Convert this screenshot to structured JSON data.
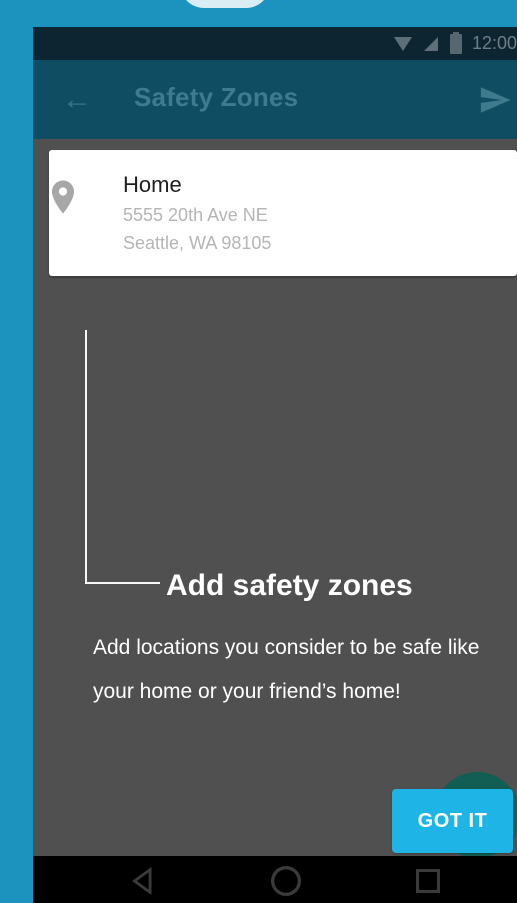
{
  "statusbar": {
    "time": "12:00",
    "icons": [
      "wifi-icon",
      "signal-icon",
      "battery-icon"
    ]
  },
  "toolbar": {
    "title": "Safety Zones",
    "back_icon": "arrow-left-icon",
    "send_icon": "send-icon"
  },
  "zone_card": {
    "name": "Home",
    "address_line1": "5555 20th Ave NE",
    "address_line2": "Seattle, WA 98105",
    "pin_icon": "location-pin-icon"
  },
  "coachmark": {
    "title": "Add safety zones",
    "body": "Add locations you consider to be safe like your home or your friend’s home!",
    "cta_label": "GOT IT"
  },
  "navbar": {
    "icons": [
      "back-triangle-icon",
      "home-circle-icon",
      "recents-square-icon"
    ]
  },
  "colors": {
    "background": "#1b93be",
    "toolbar": "#0f4d63",
    "overlay": "#505050",
    "button": "#1eb5e6",
    "fab": "#0f5f54"
  }
}
